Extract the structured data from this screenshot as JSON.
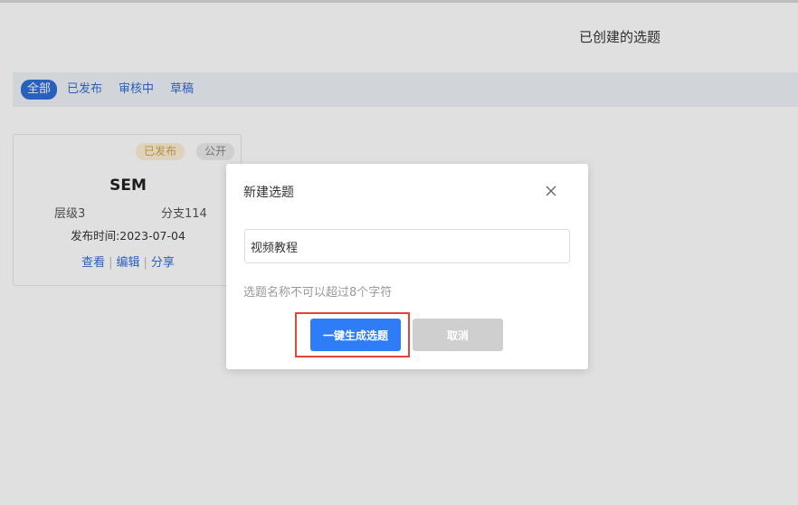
{
  "page": {
    "heading": "已创建的选题"
  },
  "filters": {
    "tabs": [
      {
        "label": "全部",
        "active": true
      },
      {
        "label": "已发布",
        "active": false
      },
      {
        "label": "审核中",
        "active": false
      },
      {
        "label": "草稿",
        "active": false
      }
    ]
  },
  "card": {
    "status_badge": "已发布",
    "visibility_badge": "公开",
    "title": "SEM",
    "level": "层级3",
    "branches": "分支114",
    "published_date": "发布时间:2023-07-04",
    "actions": {
      "view": "查看",
      "edit": "编辑",
      "share": "分享"
    }
  },
  "dialog": {
    "title": "新建选题",
    "close_icon": "close-icon",
    "input_value": "视频教程",
    "hint": "选题名称不可以超过8个字符",
    "confirm_label": "一键生成选题",
    "cancel_label": "取消"
  },
  "colors": {
    "accent": "#2e7df6",
    "link": "#2f6ed6",
    "highlight": "#e0463c",
    "cancel": "#cfcfcf"
  }
}
